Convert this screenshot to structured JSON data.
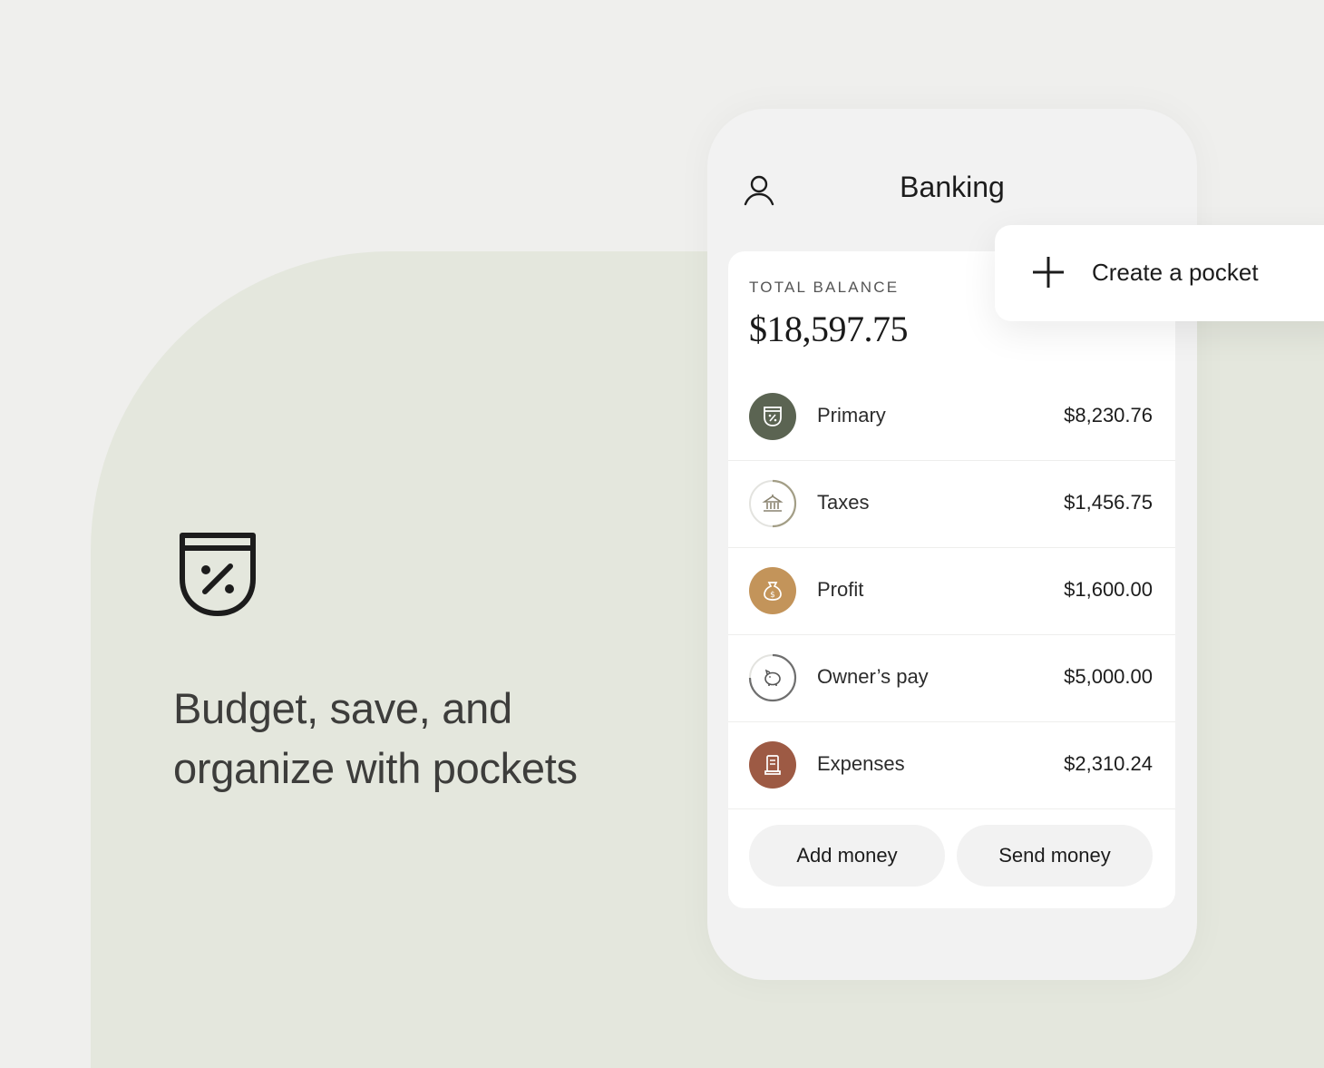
{
  "colors": {
    "background": "#efefed",
    "panel": "#e4e7dd",
    "primary_icon_bg": "#5b6452",
    "profit_icon_bg": "#c3945a",
    "expenses_icon_bg": "#9d5a44"
  },
  "hero": {
    "icon": "pocket-percent-icon",
    "line1": "Budget, save, and",
    "line2": "organize with pockets"
  },
  "phone": {
    "title": "Banking",
    "profile_icon": "profile-icon",
    "balance": {
      "label": "TOTAL BALANCE",
      "value": "$18,597.75"
    },
    "pockets": [
      {
        "name": "Primary",
        "amount": "$8,230.76",
        "icon": "pocket-percent-icon"
      },
      {
        "name": "Taxes",
        "amount": "$1,456.75",
        "icon": "government-building-icon",
        "progress": 0.5
      },
      {
        "name": "Profit",
        "amount": "$1,600.00",
        "icon": "money-bag-icon"
      },
      {
        "name": "Owner’s pay",
        "amount": "$5,000.00",
        "icon": "piggy-bank-icon",
        "progress": 0.75
      },
      {
        "name": "Expenses",
        "amount": "$2,310.24",
        "icon": "receipt-icon"
      }
    ],
    "actions": {
      "add": "Add money",
      "send": "Send money"
    }
  },
  "create_pocket": {
    "icon": "plus-icon",
    "label": "Create a pocket"
  }
}
